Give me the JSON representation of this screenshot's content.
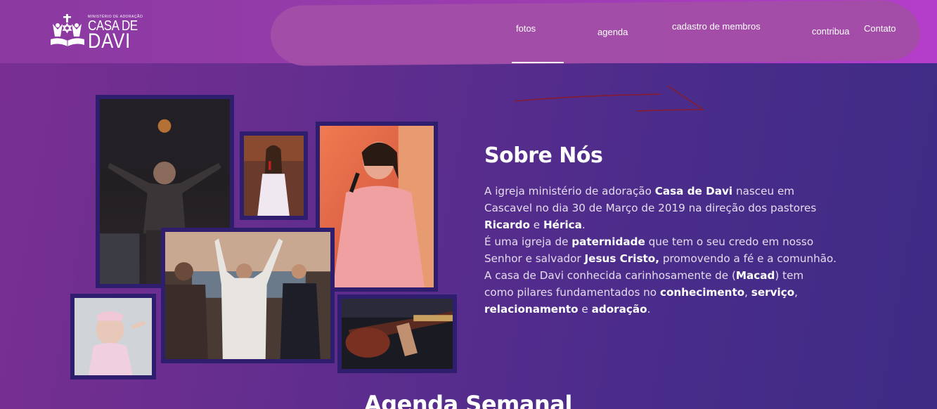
{
  "header": {
    "logo": {
      "tagline": "MINISTÉRIO DE ADORAÇÃO",
      "line1": "CASA DE",
      "line2": "DAVI"
    },
    "nav": [
      {
        "label": "fotos",
        "active": true
      },
      {
        "label": "agenda"
      },
      {
        "label": "cadastro de membros"
      },
      {
        "label": "contribua"
      },
      {
        "label": "Contato"
      }
    ]
  },
  "about": {
    "title": "Sobre Nós",
    "p1": {
      "a": "A igreja ministério de adoração ",
      "b": "Casa de Davi",
      "c": " nasceu em",
      "d": "Cascavel no dia 30 de Março de 2019 na direção dos pastores",
      "e": "Ricardo",
      "f": " e ",
      "g": "Hérica",
      "h": "."
    },
    "p2": {
      "a": "É uma igreja de ",
      "b": "paternidade",
      "c": " que tem o seu credo em nosso",
      "d": "Senhor e salvador ",
      "e": "Jesus Cristo,",
      "f": " promovendo a fé e a comunhão."
    },
    "p3": {
      "a": "A casa de Davi conhecida carinhosamente de (",
      "b": "Macad",
      "c": ") tem",
      "d": "como pilares fundamentados no ",
      "e": "conhecimento",
      "f": ", ",
      "g": "serviço",
      "h": ",",
      "i": "relacionamento",
      "j": " e ",
      "k": "adoração",
      "l": "."
    }
  },
  "agenda": {
    "title": "Agenda Semanal"
  },
  "colors": {
    "header_gradient": [
      "#8a3aa0",
      "#b53dcb"
    ],
    "nav_blob": "#a24ea6",
    "page_gradient": [
      "#7a2f92",
      "#3d2b84"
    ],
    "photo_border": "#2f1e6e"
  }
}
